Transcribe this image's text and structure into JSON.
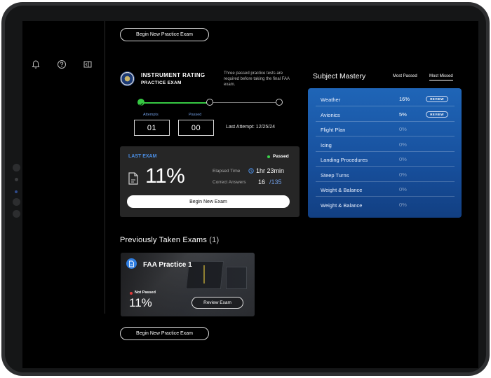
{
  "top_button_label": "Begin New Practice Exam",
  "bottom_button_label": "Begin New Practice Exam",
  "sidebar": {
    "icons": [
      "bell-icon",
      "help-icon",
      "panel-toggle-icon"
    ]
  },
  "exam": {
    "title": "INSTRUMENT RATING",
    "subtitle": "PRACTICE EXAM",
    "note": "Three passed practice tests are required before taking the final FAA exam.",
    "progress_completed": 1,
    "progress_total": 3,
    "attempts_label": "Attempts",
    "attempts_value": "01",
    "passed_label": "Passed",
    "passed_value": "00",
    "last_attempt": "Last Attempt: 12/25/24"
  },
  "last_exam": {
    "label": "LAST EXAM",
    "status": "Passed",
    "score": "11%",
    "elapsed_label": "Elapsed Time",
    "elapsed_value": "1hr 23min",
    "correct_label": "Correct Answers",
    "correct_value": "16",
    "correct_total": "/135",
    "button_label": "Begin New Exam"
  },
  "mastery": {
    "title": "Subject Mastery",
    "filters": [
      "Most Passed",
      "Most Missed"
    ],
    "active_filter": "Most Missed",
    "review_label": "REVIEW",
    "subjects": [
      {
        "name": "Weather",
        "pct": "16%",
        "review": true
      },
      {
        "name": "Avionics",
        "pct": "5%",
        "review": true
      },
      {
        "name": "Flight Plan",
        "pct": "0%",
        "review": false
      },
      {
        "name": "Icing",
        "pct": "0%",
        "review": false
      },
      {
        "name": "Landing Procedures",
        "pct": "0%",
        "review": false
      },
      {
        "name": "Steep Turns",
        "pct": "0%",
        "review": false
      },
      {
        "name": "Weight & Balance",
        "pct": "0%",
        "review": false
      },
      {
        "name": "Weight & Balance",
        "pct": "0%",
        "review": false
      }
    ]
  },
  "previous": {
    "title": "Previously Taken Exams",
    "count": "(1)",
    "exams": [
      {
        "title": "FAA Practice 1",
        "status": "Not Passed",
        "score": "11%",
        "button_label": "Review Exam"
      }
    ]
  },
  "colors": {
    "accent_blue": "#4b8fe6",
    "progress_green": "#3ad44a",
    "panel_blue": "#1f65b7",
    "fail_red": "#e23b3b"
  }
}
